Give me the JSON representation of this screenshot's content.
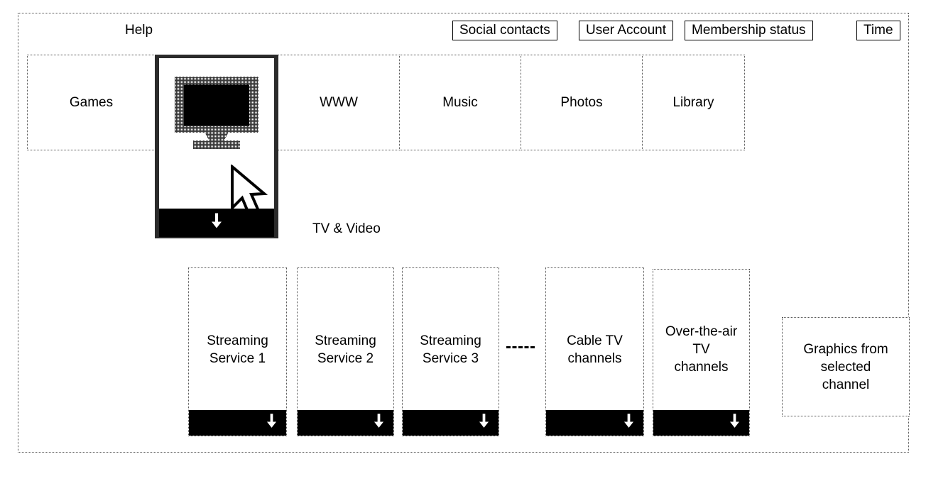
{
  "screen": {
    "help_label": "Help"
  },
  "topbar": {
    "buttons": [
      {
        "id": "social-contacts",
        "label": "Social contacts"
      },
      {
        "id": "user-account",
        "label": "User Account"
      },
      {
        "id": "membership-status",
        "label": "Membership status"
      },
      {
        "id": "time",
        "label": "Time"
      }
    ]
  },
  "nav": {
    "items": [
      {
        "id": "games",
        "label": "Games"
      },
      {
        "id": "www",
        "label": "WWW"
      },
      {
        "id": "music",
        "label": "Music"
      },
      {
        "id": "photos",
        "label": "Photos"
      },
      {
        "id": "library",
        "label": "Library"
      }
    ],
    "selected": {
      "id": "tv-video",
      "label": "TV & Video",
      "icon": "television-icon",
      "expand_arrow": "down-arrow-icon"
    }
  },
  "channels": {
    "connector": "dashed-ellipsis-connector",
    "tiles": [
      {
        "id": "streaming-service-1",
        "line1": "Streaming",
        "line2": "Service 1",
        "line3": "",
        "arrow": "down-arrow-icon"
      },
      {
        "id": "streaming-service-2",
        "line1": "Streaming",
        "line2": "Service 2",
        "line3": "",
        "arrow": "down-arrow-icon"
      },
      {
        "id": "streaming-service-3",
        "line1": "Streaming",
        "line2": "Service 3",
        "line3": "",
        "arrow": "down-arrow-icon"
      },
      {
        "id": "cable-tv-channels",
        "line1": "Cable TV",
        "line2": "channels",
        "line3": "",
        "arrow": "down-arrow-icon"
      },
      {
        "id": "over-the-air-tv-channels",
        "line1": "Over-the-air",
        "line2": "TV",
        "line3": "channels",
        "arrow": "down-arrow-icon"
      }
    ]
  },
  "preview": {
    "line1": "Graphics from",
    "line2": "selected",
    "line3": "channel"
  },
  "cursor": {
    "icon": "mouse-pointer-icon"
  },
  "colors": {
    "ink": "#000000",
    "paper": "#ffffff",
    "frame": "#555555",
    "selection_border": "#2b2b2b"
  }
}
